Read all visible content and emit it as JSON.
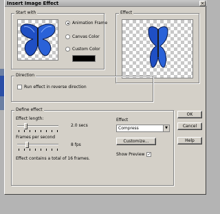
{
  "dialog": {
    "title": "Insert Image Effect",
    "close_glyph": "×"
  },
  "start_with": {
    "legend": "Start with",
    "options": [
      "Animation Frame",
      "Canvas Color",
      "Custom Color"
    ],
    "selected": "Animation Frame",
    "custom_color": "#000000"
  },
  "effect_preview": {
    "legend": "Effect"
  },
  "direction": {
    "legend": "Direction",
    "reverse_label": "Run effect in reverse direction",
    "reverse_checked": false
  },
  "define_effect": {
    "legend": "Define effect",
    "length_label": "Effect length:",
    "length_value": "2.0 secs",
    "length_fraction": 0.18,
    "fps_label": "Frames per second",
    "fps_value": "8 fps",
    "fps_fraction": 0.22,
    "summary": "Effect contains a total of 16 frames.",
    "effect_label": "Effect",
    "effect_value": "Compress",
    "customize_label": "Customize...",
    "show_preview_label": "Show Preview",
    "show_preview_checked": true,
    "check_glyph": "✓"
  },
  "buttons": {
    "ok": "OK",
    "cancel": "Cancel",
    "help": "Help"
  },
  "combo_arrow": "▼",
  "colors": {
    "dialog_bg": "#d4d0c8",
    "butterfly_blue": "#1f4fc4",
    "butterfly_dark": "#0a1a4a"
  }
}
